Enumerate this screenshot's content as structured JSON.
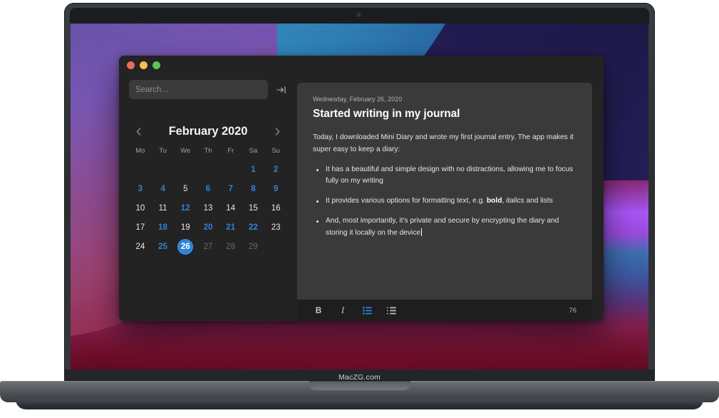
{
  "mockup": {
    "device_label": "MacZG.com",
    "accent_color": "#2f84d8",
    "window_bg": "#232323",
    "card_bg": "#3a3a3a"
  },
  "window": {
    "traffic_lights": [
      {
        "name": "close",
        "color": "#ec6a5f"
      },
      {
        "name": "minimize",
        "color": "#f4bf4f"
      },
      {
        "name": "zoom",
        "color": "#61c554"
      }
    ]
  },
  "sidebar": {
    "search": {
      "placeholder": "Search...",
      "value": ""
    },
    "toggle_icon": "arrow-to-bar-icon",
    "calendar": {
      "prev_label": "‹",
      "next_label": "›",
      "month_title": "February 2020",
      "weekdays": [
        "Mo",
        "Tu",
        "We",
        "Th",
        "Fr",
        "Sa",
        "Su"
      ],
      "leading_blanks": 5,
      "days": [
        {
          "n": "1",
          "state": "has-entry"
        },
        {
          "n": "2",
          "state": "has-entry"
        },
        {
          "n": "3",
          "state": "has-entry"
        },
        {
          "n": "4",
          "state": "has-entry"
        },
        {
          "n": "5",
          "state": "plain"
        },
        {
          "n": "6",
          "state": "has-entry"
        },
        {
          "n": "7",
          "state": "has-entry"
        },
        {
          "n": "8",
          "state": "has-entry"
        },
        {
          "n": "9",
          "state": "has-entry"
        },
        {
          "n": "10",
          "state": "plain"
        },
        {
          "n": "11",
          "state": "plain"
        },
        {
          "n": "12",
          "state": "has-entry"
        },
        {
          "n": "13",
          "state": "plain"
        },
        {
          "n": "14",
          "state": "plain"
        },
        {
          "n": "15",
          "state": "plain"
        },
        {
          "n": "16",
          "state": "plain"
        },
        {
          "n": "17",
          "state": "plain"
        },
        {
          "n": "18",
          "state": "has-entry"
        },
        {
          "n": "19",
          "state": "plain"
        },
        {
          "n": "20",
          "state": "has-entry"
        },
        {
          "n": "21",
          "state": "has-entry"
        },
        {
          "n": "22",
          "state": "has-entry"
        },
        {
          "n": "23",
          "state": "plain"
        },
        {
          "n": "24",
          "state": "plain"
        },
        {
          "n": "25",
          "state": "has-entry"
        },
        {
          "n": "26",
          "state": "selected"
        },
        {
          "n": "27",
          "state": "muted"
        },
        {
          "n": "28",
          "state": "muted"
        },
        {
          "n": "29",
          "state": "muted"
        }
      ]
    }
  },
  "editor": {
    "entry_date": "Wednesday, February 26, 2020",
    "entry_title": "Started writing in my journal",
    "paragraph": "Today, I downloaded Mini Diary and wrote my first journal entry. The app makes it super easy to keep a diary:",
    "bullets": [
      {
        "segments": [
          {
            "text": "It has a beautiful and simple design with no distractions, allowing me to focus fully on my writing",
            "style": "normal"
          }
        ]
      },
      {
        "segments": [
          {
            "text": "It provides various options for formatting text, e.g. ",
            "style": "normal"
          },
          {
            "text": "bold",
            "style": "bold"
          },
          {
            "text": ", ",
            "style": "normal"
          },
          {
            "text": "italics",
            "style": "italic"
          },
          {
            "text": " and lists",
            "style": "normal"
          }
        ]
      },
      {
        "segments": [
          {
            "text": "And, most importantly, it's private and secure by encrypting the diary and storing it locally on the device",
            "style": "normal"
          }
        ]
      }
    ],
    "cursor_after_last_bullet": true,
    "toolbar": {
      "bold_label": "B",
      "italic_label": "I",
      "bullet_list_icon": "bullet-list-icon",
      "bullet_list_active": true,
      "ordered_list_icon": "ordered-list-icon",
      "ordered_list_active": false,
      "word_count": "76"
    }
  }
}
